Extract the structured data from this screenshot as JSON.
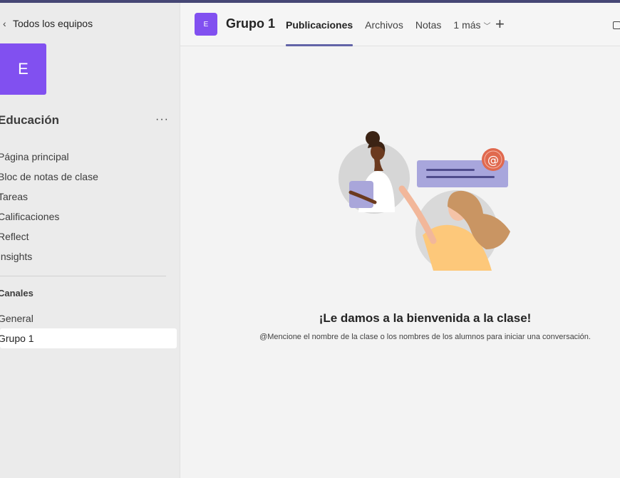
{
  "sidebar": {
    "back_label": "Todos los equipos",
    "team_initial": "E",
    "team_name": "Educación",
    "more_label": "···",
    "nav_items": [
      {
        "label": "Página principal"
      },
      {
        "label": "Bloc de notas de clase"
      },
      {
        "label": "Tareas"
      },
      {
        "label": "Calificaciones"
      },
      {
        "label": "Reflect"
      },
      {
        "label": "Insights"
      }
    ],
    "channels_heading": "Canales",
    "channels": [
      {
        "label": "General"
      },
      {
        "label": "Grupo 1",
        "active": true
      }
    ]
  },
  "header": {
    "channel_initial": "E",
    "channel_title": "Grupo 1",
    "tabs": [
      {
        "label": "Publicaciones",
        "active": true
      },
      {
        "label": "Archivos"
      },
      {
        "label": "Notas"
      },
      {
        "label": "1 más"
      }
    ],
    "add_label": "+"
  },
  "main": {
    "welcome_title": "¡Le damos a la bienvenida a la clase!",
    "welcome_subtitle": "@Mencione el nombre de la clase o los nombres de los alumnos para iniciar una conversación."
  },
  "colors": {
    "accent": "#6264a7",
    "team_avatar": "#8150f0",
    "top_bar": "#464775",
    "mention_badge": "#e0694e"
  },
  "icons": {
    "back": "chevron-left-icon",
    "more": "more-horizontal-icon",
    "dropdown": "chevron-down-icon",
    "add": "plus-icon",
    "window": "square-icon",
    "mention": "at-sign-icon"
  }
}
